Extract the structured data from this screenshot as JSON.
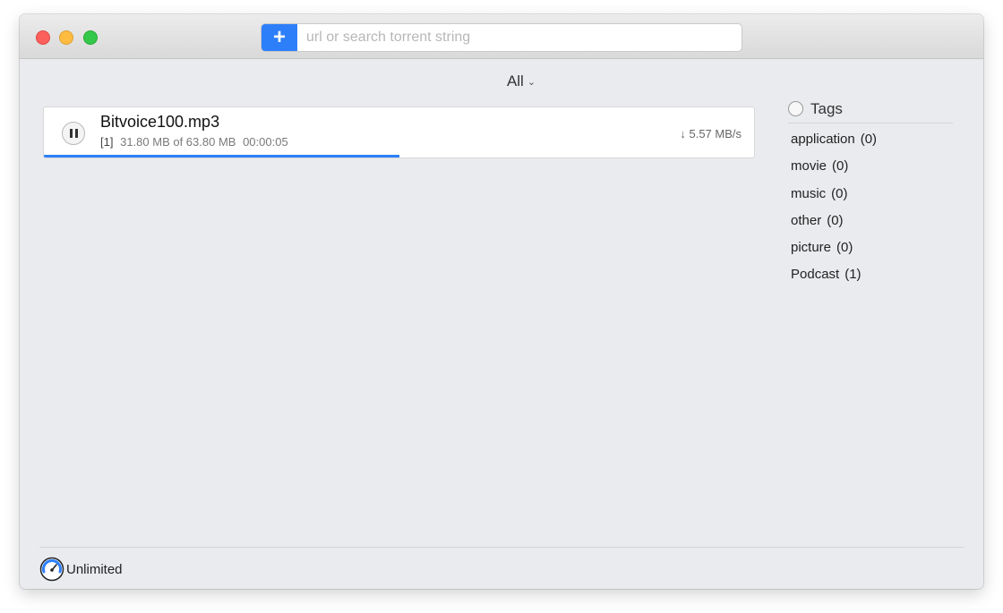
{
  "window": {
    "traffic_lights": {
      "close": "#fc605c",
      "minimize": "#fdbc40",
      "maximize": "#34c84a"
    }
  },
  "toolbar": {
    "add_icon": "plus-icon",
    "add_label": "+",
    "search_placeholder": "url or search torrent string",
    "search_value": ""
  },
  "filter": {
    "selected": "All",
    "icon": "chevron-down-icon",
    "chevron": "⌄"
  },
  "torrents": [
    {
      "name": "Bitvoice100.mp3",
      "index_label": "[1]",
      "downloaded": "31.80 MB of 63.80 MB",
      "eta": "00:00:05",
      "speed": "↓ 5.57 MB/s",
      "progress": 0.5,
      "state_icon": "pause-icon"
    }
  ],
  "tags": {
    "title": "Tags",
    "items": [
      {
        "label": "application",
        "count": "(0)"
      },
      {
        "label": "movie",
        "count": "(0)"
      },
      {
        "label": "music",
        "count": "(0)"
      },
      {
        "label": "other",
        "count": "(0)"
      },
      {
        "label": "picture",
        "count": "(0)"
      },
      {
        "label": "Podcast",
        "count": "(1)"
      }
    ]
  },
  "footer": {
    "limit_icon": "speedometer-icon",
    "limit_label": "Unlimited"
  },
  "colors": {
    "accent": "#2d7ff9",
    "window_bg": "#e9ebee"
  }
}
